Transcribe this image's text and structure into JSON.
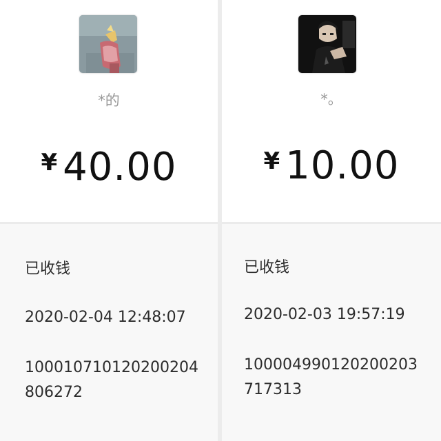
{
  "receipts": [
    {
      "avatar_icon": "user-avatar-holding-object",
      "nickname": "*的",
      "currency": "¥",
      "amount": "40.00",
      "status": "已收钱",
      "time": "2020-02-04 12:48:07",
      "transaction_id_line1": "100010710120200204",
      "transaction_id_line2": "806272"
    },
    {
      "avatar_icon": "user-avatar-portrait-dark",
      "nickname": "*。",
      "currency": "¥",
      "amount": "10.00",
      "status": "已收钱",
      "time": "2020-02-03 19:57:19",
      "transaction_id_line1": "100004990120200203",
      "transaction_id_line2": "717313"
    }
  ]
}
